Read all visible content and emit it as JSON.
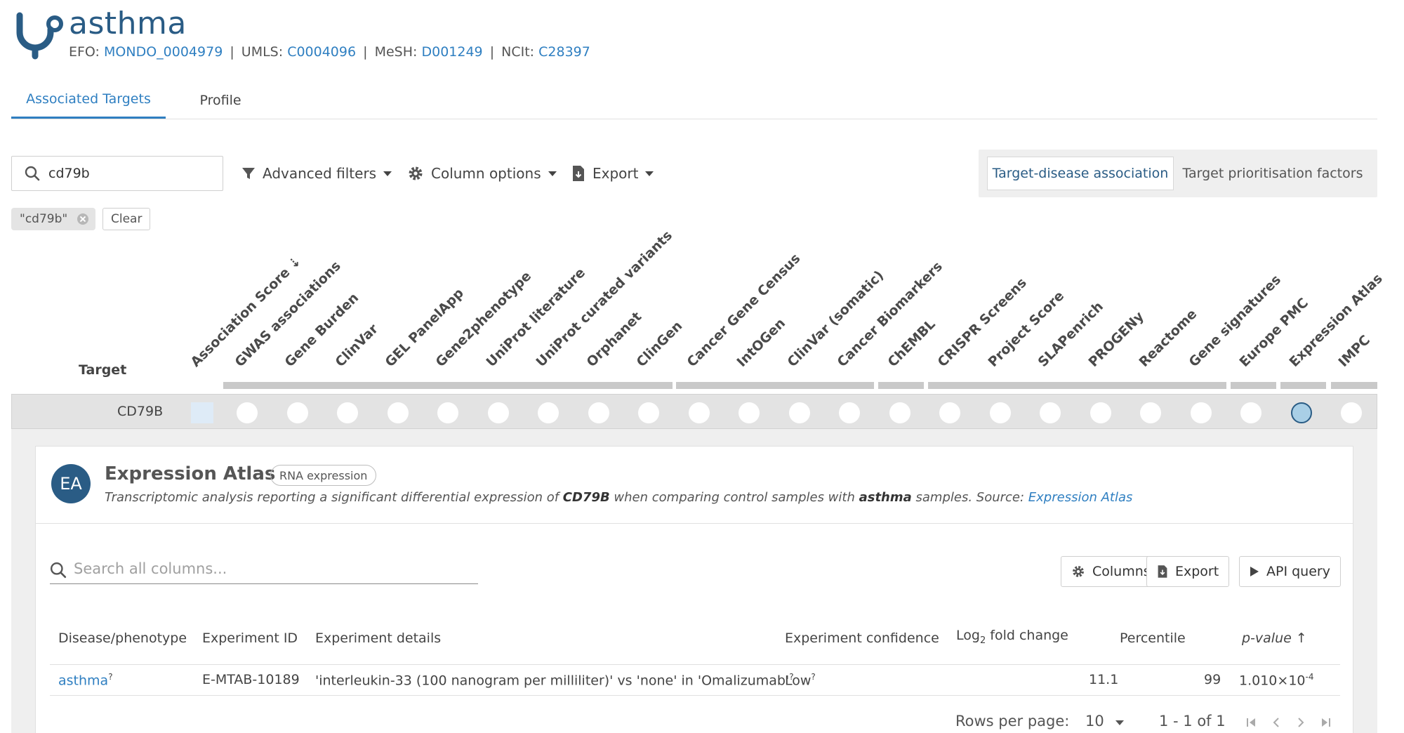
{
  "header": {
    "title": "asthma",
    "ids": [
      {
        "label": "EFO:",
        "value": "MONDO_0004979"
      },
      {
        "label": "UMLS:",
        "value": "C0004096"
      },
      {
        "label": "MeSH:",
        "value": "D001249"
      },
      {
        "label": "NCIt:",
        "value": "C28397"
      }
    ],
    "separator": "|"
  },
  "tabs": [
    {
      "label": "Associated Targets",
      "active": true
    },
    {
      "label": "Profile",
      "active": false
    }
  ],
  "toolbar": {
    "search_value": "cd79b",
    "advanced_filters": "Advanced filters",
    "column_options": "Column options",
    "export": "Export",
    "view_selected": "Target-disease association",
    "view_other": "Target prioritisation factors"
  },
  "filter_chip": {
    "label": "\"cd79b\"",
    "clear": "Clear"
  },
  "columns": {
    "target": "Target",
    "datatypes": [
      "Association Score",
      "GWAS associations",
      "Gene Burden",
      "ClinVar",
      "GEL PanelApp",
      "Gene2phenotype",
      "UniProt literature",
      "UniProt curated variants",
      "Orphanet",
      "ClinGen",
      "Cancer Gene Census",
      "IntOGen",
      "ClinVar (somatic)",
      "Cancer Biomarkers",
      "ChEMBL",
      "CRISPR Screens",
      "Project Score",
      "SLAPenrich",
      "PROGENy",
      "Reactome",
      "Gene signatures",
      "Europe PMC",
      "Expression Atlas",
      "IMPC"
    ]
  },
  "row": {
    "target": "CD79B"
  },
  "detail": {
    "badge": "EA",
    "title": "Expression Atlas",
    "tag": "RNA expression",
    "desc_pre": "Transcriptomic analysis reporting a significant differential expression of ",
    "desc_gene": "CD79B",
    "desc_mid": " when comparing control samples with ",
    "desc_disease": "asthma",
    "desc_post": " samples. Source: ",
    "desc_link": "Expression Atlas",
    "search_placeholder": "Search all columns...",
    "btn_columns": "Columns",
    "btn_export": "Export",
    "btn_api": "API query",
    "table": {
      "headers": {
        "disease": "Disease/phenotype",
        "experiment_id": "Experiment ID",
        "experiment_details": "Experiment details",
        "confidence": "Experiment confidence",
        "log_pre": "Log",
        "log_sub": "2",
        "log_post": " fold change",
        "percentile": "Percentile",
        "pvalue": "p-value"
      },
      "rows": [
        {
          "disease": "asthma",
          "experiment_id": "E-MTAB-10189",
          "experiment_details": "'interleukin-33 (100 nanogram per milliliter)' vs 'none' in 'Omalizumab'",
          "confidence": "Low",
          "log_fc": "11.1",
          "percentile": "99",
          "pvalue_base": "1.010×10",
          "pvalue_exp": "-4"
        }
      ]
    },
    "pager": {
      "rows_label": "Rows per page:",
      "rows_value": "10",
      "range": "1 - 1 of 1"
    }
  },
  "colors": {
    "accent": "#2f7fc1",
    "brand": "#2a5c85"
  }
}
